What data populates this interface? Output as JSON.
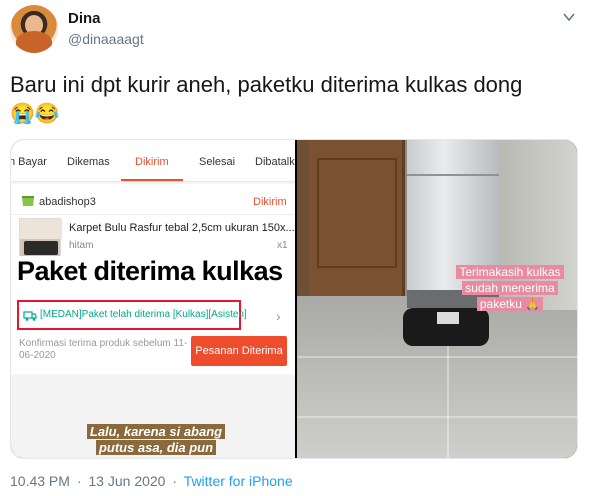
{
  "user": {
    "display_name": "Dina",
    "handle": "@dinaaaagt"
  },
  "tweet": {
    "text": "Baru ini dpt kurir aneh, paketku diterima kulkas dong",
    "emojis": "😭😂"
  },
  "media": {
    "left": {
      "tabs": [
        "n Bayar",
        "Dikemas",
        "Dikirim",
        "Selesai",
        "Dibatalk"
      ],
      "active_tab": "Dikirim",
      "shop_name": "abadishop3",
      "order_status": "Dikirim",
      "product_name": "Karpet Bulu Rasfur tebal 2,5cm ukuran 150x...",
      "variant": "hitam",
      "quantity": "x1",
      "overlay_caption": "Paket diterima kulkas",
      "tracking_text": "[MEDAN]Paket telah diterima [Kulkas][Asisten]",
      "confirm_text": "Konfirmasi terima produk sebelum 11-06-2020",
      "receive_button": "Pesanan Diterima",
      "story_caption": "Lalu, karena si abang putus asa, dia pun"
    },
    "right": {
      "story_caption": "Terimakasih kulkas sudah menerima paketku 🙏"
    }
  },
  "footer": {
    "time": "10.43 PM",
    "date": "13 Jun 2020",
    "source": "Twitter for iPhone"
  },
  "colors": {
    "shopee_orange": "#ee4d2d",
    "highlight_red": "#e8162c",
    "tracking_green": "#00a98f",
    "twitter_blue": "#1da1f2"
  },
  "icons": [
    "caret-down-icon",
    "shop-icon",
    "truck-icon",
    "chevron-right-icon"
  ]
}
